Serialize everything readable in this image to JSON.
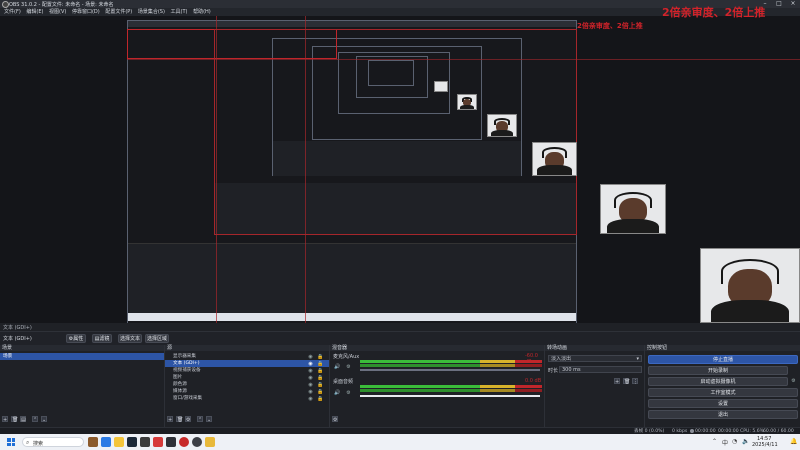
{
  "window": {
    "title": "OBS 31.0.2 - 配置文件: 未命名 - 场景: 未命名"
  },
  "menu": [
    "文件(F)",
    "编辑(E)",
    "视图(V)",
    "停靠窗口(D)",
    "配置文件(P)",
    "场景集合(S)",
    "工具(T)",
    "帮助(H)"
  ],
  "overlay": {
    "line1": "2倍亲审度、2倍上推",
    "line2": "2倍亲审度、2倍上推"
  },
  "source_badge": "文本 (GDI+)",
  "scene_toolbar": {
    "source_name": "文本 (GDI+)",
    "properties": "属性",
    "filters": "滤镜",
    "select_text": "选择文本",
    "select_area": "选择区域"
  },
  "docks": {
    "scenes": {
      "title": "场景",
      "items": [
        "场景"
      ]
    },
    "sources": {
      "title": "源",
      "items": [
        "显示器采集",
        "文本 (GDI+)",
        "视频捕获设备",
        "图片",
        "颜色源",
        "媒体源",
        "窗口/游戏采集"
      ]
    },
    "mixer": {
      "title": "混音器",
      "ch1": {
        "name": "麦克风/Aux",
        "db": "-60.0 dB"
      },
      "ch2": {
        "name": "桌面音频",
        "db": "0.0 dB"
      }
    },
    "transitions": {
      "title": "转场动画",
      "type": "淡入淡出",
      "duration_label": "时长",
      "duration_value": "300 ms"
    },
    "controls": {
      "title": "控制按钮",
      "buttons": [
        "停止直播",
        "开始录制",
        "启动虚拟摄像机",
        "工作室模式",
        "设置",
        "退出"
      ]
    }
  },
  "status": {
    "frames": "丢帧 0 (0.0%)",
    "kbps": "0 kbps",
    "time1": "00:00:00",
    "time2": "00:00:00",
    "cpu": "CPU: 5.6%",
    "fps": "60.00 / 60.00 FPS"
  },
  "taskbar": {
    "search": "搜索",
    "time": "14:57",
    "date": "2025/4/11",
    "lang": "中"
  },
  "colors": {
    "accent": "#2d55a6",
    "record": "#c0262b",
    "meter_green": "#3bbd3a",
    "meter_yellow": "#d7b32b",
    "meter_red": "#c0262b"
  }
}
